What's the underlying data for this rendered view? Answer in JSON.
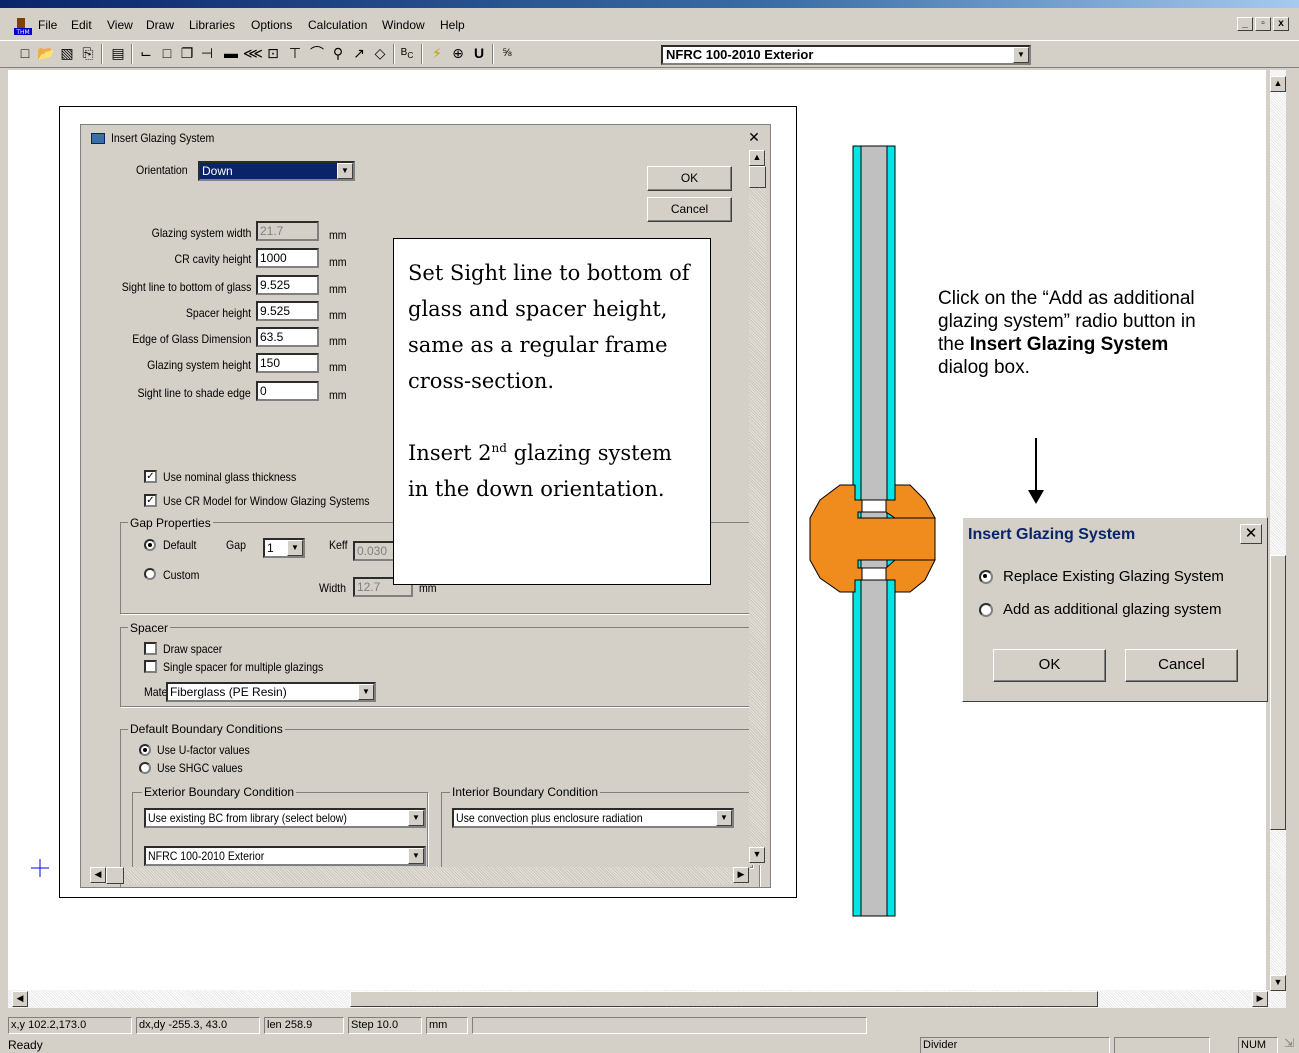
{
  "menu": [
    "File",
    "Edit",
    "View",
    "Draw",
    "Libraries",
    "Options",
    "Calculation",
    "Window",
    "Help"
  ],
  "mdi_controls": [
    "_",
    "▫",
    "x"
  ],
  "toolbar": {
    "icons": [
      "new-file-icon",
      "open-folder-icon",
      "save-icon",
      "print-icon",
      "properties-icon",
      "polygon-icon",
      "rectangle-icon",
      "copy-polygon-icon",
      "insert-point-icon",
      "fill-icon",
      "locate-icon",
      "frame-cavity-icon",
      "insert-glazing-icon",
      "arc-icon",
      "zoom-icon",
      "pick-icon",
      "rotate-icon",
      "boundary-condition-icon",
      "calculate-icon",
      "results-icon",
      "u-factor-icon",
      "units-icon"
    ],
    "bc_library": "NFRC 100-2010 Exterior"
  },
  "dialog": {
    "title": "Insert Glazing System",
    "orientation_label": "Orientation",
    "orientation_value": "Down",
    "ok": "OK",
    "cancel": "Cancel",
    "fields": [
      {
        "label": "Glazing system width",
        "value": "21.7",
        "unit": "mm",
        "disabled": true
      },
      {
        "label": "CR cavity height",
        "value": "1000",
        "unit": "mm",
        "disabled": false
      },
      {
        "label": "Sight line to bottom of glass",
        "value": "9.525",
        "unit": "mm",
        "disabled": false
      },
      {
        "label": "Spacer height",
        "value": "9.525",
        "unit": "mm",
        "disabled": false
      },
      {
        "label": "Edge of Glass Dimension",
        "value": "63.5",
        "unit": "mm",
        "disabled": false
      },
      {
        "label": "Glazing system height",
        "value": "150",
        "unit": "mm",
        "disabled": false
      },
      {
        "label": "Sight line to shade edge",
        "value": "0",
        "unit": "mm",
        "disabled": false
      }
    ],
    "use_nominal": "Use nominal glass thickness",
    "use_cr_model": "Use CR Model for Window Glazing Systems",
    "gap_properties": "Gap Properties",
    "gap_default": "Default",
    "gap_custom": "Custom",
    "gap_label": "Gap",
    "gap_value": "1",
    "keff_label": "Keff",
    "keff_value": "0.030",
    "width_label": "Width",
    "width_value": "12.7",
    "width_unit": "mm",
    "spacer": "Spacer",
    "draw_spacer": "Draw spacer",
    "single_spacer": "Single spacer for multiple glazings",
    "material_label": "Material",
    "material_value": "Fiberglass (PE Resin)",
    "default_bc": "Default Boundary Conditions",
    "use_ufactor": "Use U-factor values",
    "use_shgc": "Use SHGC values",
    "exterior_bc": "Exterior Boundary Condition",
    "exterior_bc_value": "Use existing BC from library (select below)",
    "exterior_bc_library": "NFRC 100-2010 Exterior",
    "interior_bc": "Interior Boundary Condition",
    "interior_bc_value": "Use convection plus enclosure radiation"
  },
  "callout": {
    "p1": "Set Sight line to bottom of glass and spacer height, same as a regular frame cross-section.",
    "p2_before": "Insert 2",
    "p2_sup": "nd",
    "p2_after": " glazing system in the down orientation."
  },
  "instruction": {
    "t1": "Click on the “Add as additional glazing system” radio button in the ",
    "bold": "Insert Glazing System",
    "t2": " dialog box."
  },
  "small_dialog": {
    "title": "Insert Glazing System",
    "opt1": "Replace Existing Glazing System",
    "opt2": "Add as additional glazing system",
    "ok": "OK",
    "cancel": "Cancel"
  },
  "status": {
    "xy": "x,y 102.2,173.0",
    "dxdy": "dx,dy -255.3, 43.0",
    "len": "len 258.9",
    "step": "Step 10.0",
    "unit": "mm",
    "ready": "Ready",
    "divider": "Divider",
    "num": "NUM"
  },
  "colors": {
    "glass_edge": "#00e5e5",
    "glass_fill": "#c0c0c0",
    "spacer": "#f08c1e",
    "title_blue": "#0a246a"
  }
}
